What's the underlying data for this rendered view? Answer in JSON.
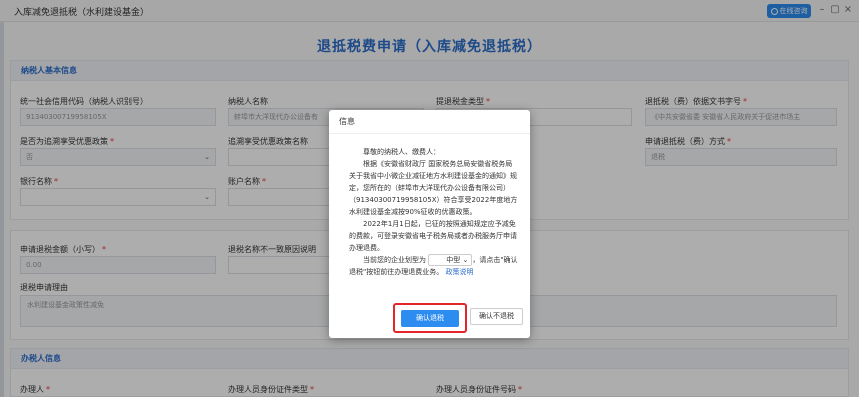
{
  "window": {
    "title": "入库减免退抵税（水利建设基金）",
    "online_help_label": "在线咨询",
    "controls": [
      "–",
      "▢",
      "⤢",
      "×"
    ]
  },
  "page_title": "退抵税费申请（入库减免退抵税）",
  "section_taxpayer": {
    "title": "纳税人基本信息",
    "fields": {
      "credit_code_label": "统一社会信用代码（纳税人识别号）",
      "credit_code_value": "91340300719958105X",
      "taxpayer_name_label": "纳税人名称",
      "taxpayer_name_value": "蚌埠市大洋现代办公设备有",
      "refund_type_label": "提退税金类型",
      "basis_doc_label": "退抵税（费）依据文书字号",
      "basis_doc_value": "《中共安徽省委 安徽省人民政府关于促进市场主",
      "policy_label": "是否为追溯享受优惠政策",
      "policy_value": "否",
      "policy_name_label": "追溯享受优惠政策名称",
      "method_label": "申请退抵税（费）方式",
      "method_value": "退税",
      "bank_label": "银行名称",
      "account_label": "账户名称"
    }
  },
  "section_apply": {
    "amount_label": "申请退税金额（小写）",
    "amount_value": "0.00",
    "mismatch_label": "退税名称不一致原因说明",
    "reason_label": "退税申请理由",
    "reason_value": "水利建设基金政策性减免"
  },
  "section_handler": {
    "title": "办税人信息",
    "handler_label": "办理人",
    "id_type_label": "办理人员身份证件类型",
    "id_no_label": "办理人员身份证件号码"
  },
  "modal": {
    "title": "信息",
    "greeting": "尊敬的纳税人、缴费人：",
    "para1": "根据《安徽省财政厅 国家税务总局安徽省税务局关于我省中小微企业减征地方水利建设基金的通知》规定，您所在的（蚌埠市大洋现代办公设备有限公司）（91340300719958105X）符合享受2022年度地方水利建设基金减按90%征收的优惠政策。",
    "para2": "2022年1月1日起，已征的按照通知规定应予减免的费款，可登录安徽省电子税务局或者办税服务厅申请办理退费。",
    "para3_prefix": "当前您的企业划型为",
    "enterprise_type": "中型",
    "para3_suffix": "，请点击\"确认退税\"按钮前往办理退费业务。",
    "policy_link": "政策说明",
    "confirm_label": "确认退税",
    "decline_label": "确认不退税"
  }
}
